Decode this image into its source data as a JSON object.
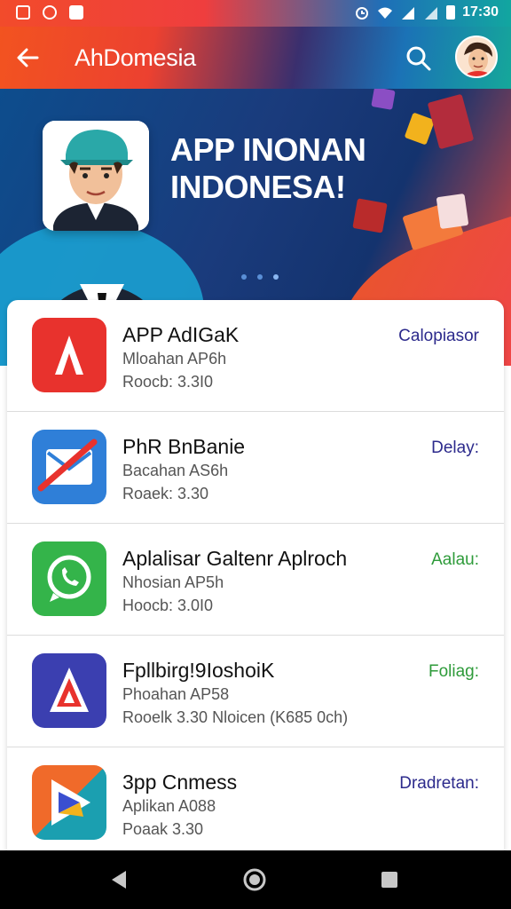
{
  "status_bar": {
    "time": "17:30"
  },
  "app_bar": {
    "title": "AhDomesia"
  },
  "banner": {
    "headline": "APP INONAN INDONESA!",
    "slide_count": 3,
    "active_slide": 3
  },
  "apps": [
    {
      "name": "APP AdIGaK",
      "subtitle": "Mloahan AP6h",
      "version": "Roocb: 3.3I0",
      "status": "Calopiasor",
      "status_color": "#2c2a8c",
      "icon_color": "#e8322d"
    },
    {
      "name": "PhR BnBanie",
      "subtitle": "Bacahan AS6h",
      "version": "Roaek: 3.30",
      "status": "Delay:",
      "status_color": "#2c2a8c",
      "icon_color": "#2f7fd8"
    },
    {
      "name": "Aplalisar Galtenr Aplroch",
      "subtitle": "Nhosian AP5h",
      "version": "Hoocb: 3.0I0",
      "status": "Aalau:",
      "status_color": "#2e9b3a",
      "icon_color": "#34b44a"
    },
    {
      "name": "Fpllbirg!9IoshoiK",
      "subtitle": "Phoahan AP58",
      "version": "Rooelk 3.30   Nloicen (K685 0ch)",
      "status": "Foliag:",
      "status_color": "#2e9b3a",
      "icon_color": "#3b3fb0"
    },
    {
      "name": "3pp Cnmess",
      "subtitle": "Aplikan A088",
      "version": "Poaak 3.30",
      "status": "Dradretan:",
      "status_color": "#2c2a8c",
      "icon_color": "#f06a2a"
    }
  ],
  "icons": {
    "status_left": [
      "photo-icon",
      "chat-icon",
      "video-icon"
    ],
    "status_right": [
      "alarm-icon",
      "wifi-icon",
      "signal-icon",
      "signal-icon",
      "battery-icon"
    ],
    "app_bar": [
      "back-arrow-icon",
      "search-icon",
      "user-avatar"
    ],
    "nav": [
      "back-triangle-icon",
      "home-circle-icon",
      "recents-square-icon"
    ]
  }
}
